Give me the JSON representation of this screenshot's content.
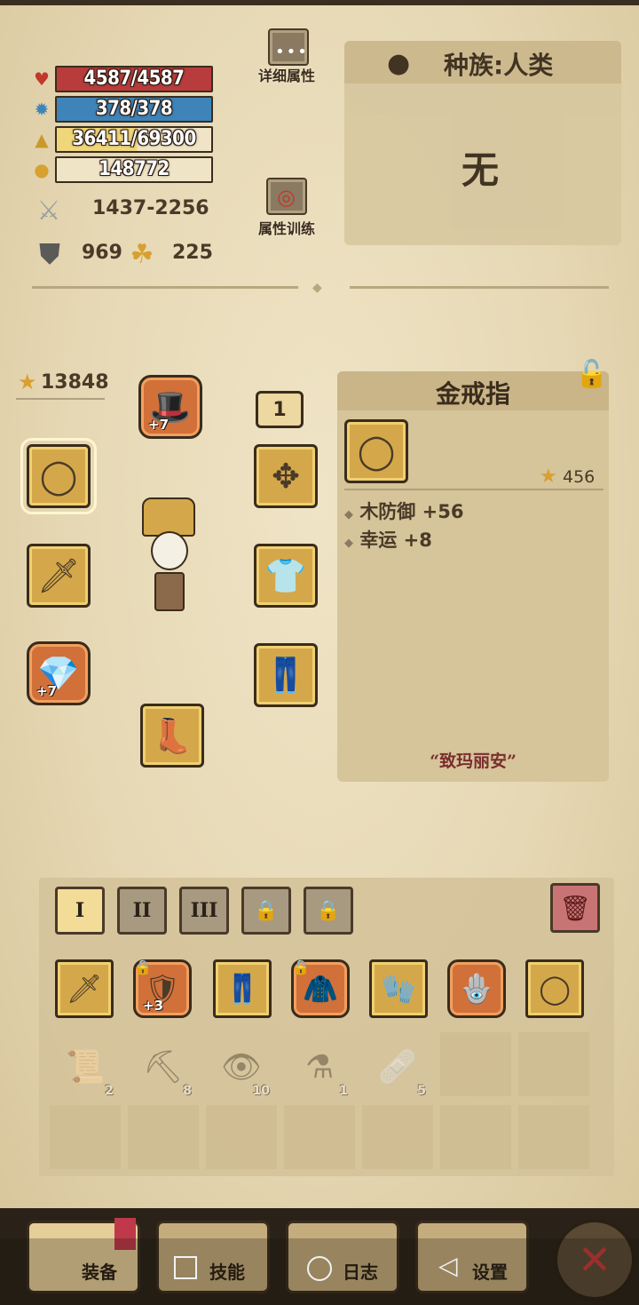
{
  "stats": {
    "hp": "4587/4587",
    "mp": "378/378",
    "xp": "36411/69300",
    "xp_progress": 0.525,
    "gold": "148772",
    "attack": "1437-2256",
    "defense": "969",
    "luck": "225"
  },
  "actions": {
    "detail_attrs": "详细属性",
    "attr_training": "属性训练"
  },
  "race": {
    "label": "种族:人类",
    "value": "无"
  },
  "gear": {
    "score": "13848",
    "set_number": "1"
  },
  "item_detail": {
    "name": "金戒指",
    "score": "456",
    "stats": [
      "木防御 +56",
      "幸运 +8"
    ],
    "quote": "“致玛丽安”"
  },
  "loadout_tabs": [
    "I",
    "II",
    "III",
    "",
    ""
  ],
  "consumables": [
    {
      "name": "scroll",
      "count": "2"
    },
    {
      "name": "pickaxe",
      "count": "8"
    },
    {
      "name": "eye-scroll",
      "count": "10"
    },
    {
      "name": "potion",
      "count": "1"
    },
    {
      "name": "bandage",
      "count": "5"
    }
  ],
  "enhance": {
    "helmet": "+7",
    "amulet": "+7",
    "bag_armor": "+3"
  },
  "nav": {
    "equipment": "装备",
    "skills": "技能",
    "journal": "日志",
    "settings": "设置"
  },
  "colors": {
    "hp": "#b83c3c",
    "mp": "#3e84b8",
    "xp": "#f0d67a",
    "slot_gold": "#d4a84a",
    "slot_orange": "#d2703a"
  }
}
